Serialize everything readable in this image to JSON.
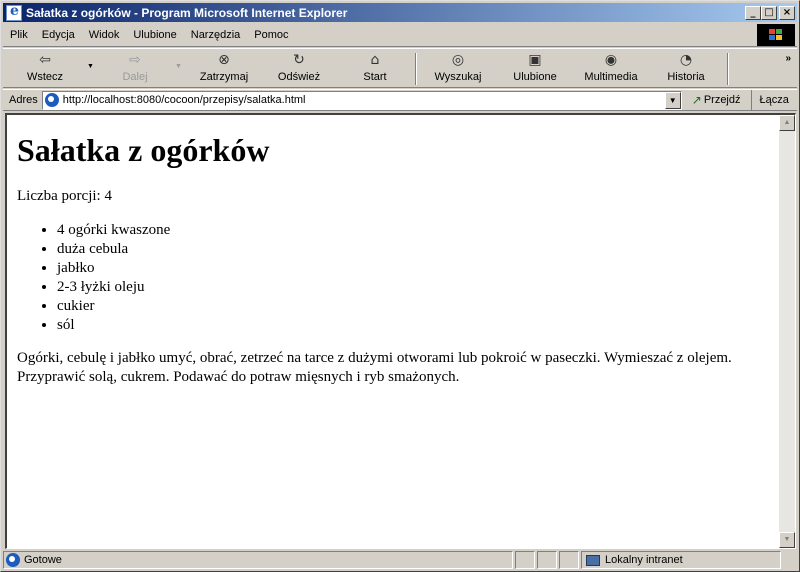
{
  "window": {
    "title": "Sałatka z ogórków - Program Microsoft Internet Explorer",
    "controls": {
      "minimize": "_",
      "maximize": "□",
      "close": "×"
    }
  },
  "menu": [
    {
      "label": "Plik"
    },
    {
      "label": "Edycja"
    },
    {
      "label": "Widok"
    },
    {
      "label": "Ulubione"
    },
    {
      "label": "Narzędzia"
    },
    {
      "label": "Pomoc"
    }
  ],
  "toolbar": {
    "back": {
      "label": "Wstecz",
      "icon": "⇦"
    },
    "forward": {
      "label": "Dalej",
      "icon": "⇨"
    },
    "stop": {
      "label": "Zatrzymaj",
      "icon": "⊗"
    },
    "refresh": {
      "label": "Odśwież",
      "icon": "↻"
    },
    "home": {
      "label": "Start",
      "icon": "⌂"
    },
    "search": {
      "label": "Wyszukaj",
      "icon": "◎"
    },
    "favorites": {
      "label": "Ulubione",
      "icon": "▣"
    },
    "media": {
      "label": "Multimedia",
      "icon": "◉"
    },
    "history": {
      "label": "Historia",
      "icon": "◔"
    },
    "more": "»",
    "dropdown": "▼"
  },
  "address": {
    "label": "Adres",
    "url": "http://localhost:8080/cocoon/przepisy/salatka.html",
    "go_label": "Przejdź",
    "go_icon": "↗",
    "links_label": "Łącza",
    "dropdown": "▼"
  },
  "page": {
    "heading": "Sałatka z ogórków",
    "servings": "Liczba porcji: 4",
    "ingredients": [
      "4 ogórki kwaszone",
      "duża cebula",
      "jabłko",
      "2-3 łyżki oleju",
      "cukier",
      "sól"
    ],
    "instructions": "Ogórki, cebulę i jabłko umyć, obrać, zetrzeć na tarce z dużymi otworami lub pokroić w paseczki. Wymieszać z olejem. Przyprawić solą, cukrem. Podawać do potraw mięsnych i ryb smażonych."
  },
  "scroll": {
    "up": "▲",
    "down": "▼"
  },
  "status": {
    "text": "Gotowe",
    "zone": "Lokalny intranet"
  }
}
